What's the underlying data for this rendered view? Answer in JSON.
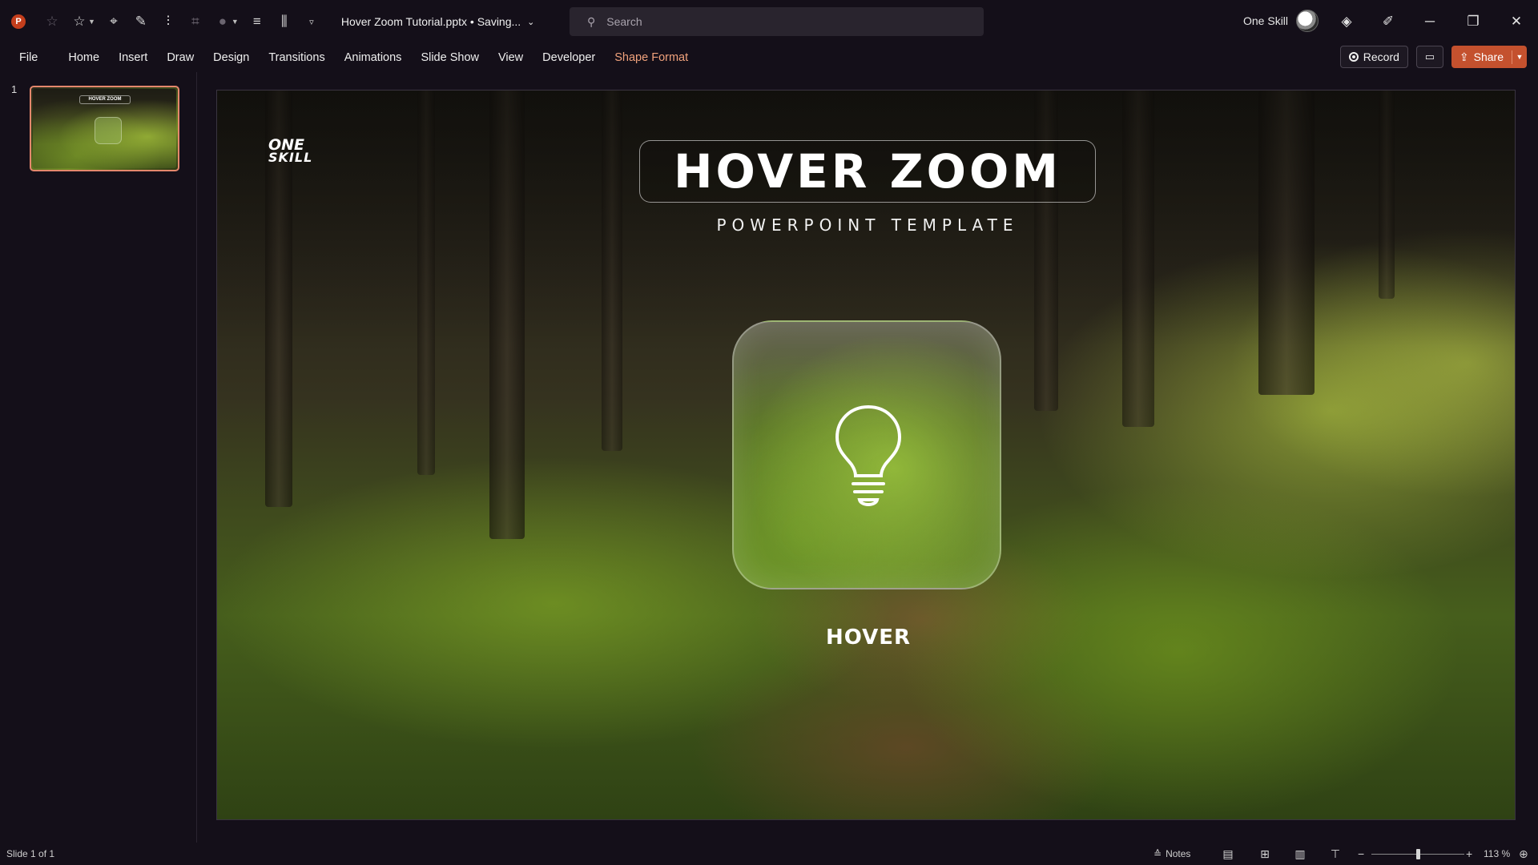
{
  "app": {
    "logo_letter": "P",
    "doc_title": "Hover Zoom Tutorial.pptx • Saving...",
    "quick_access_icons": [
      "autosave-icon",
      "star-icon",
      "lasso-icon",
      "pen-icon",
      "align-icon",
      "crop-icon",
      "shape-fill-icon",
      "distribute-icon",
      "arrange-icon",
      "customize-icon"
    ]
  },
  "search": {
    "placeholder": "Search"
  },
  "user": {
    "name": "One Skill"
  },
  "ribbon": {
    "tabs": [
      "File",
      "Home",
      "Insert",
      "Draw",
      "Design",
      "Transitions",
      "Animations",
      "Slide Show",
      "View",
      "Developer",
      "Shape Format"
    ],
    "accent_tab": "Shape Format",
    "record_label": "Record",
    "share_label": "Share"
  },
  "thumbnails": [
    {
      "number": "1",
      "title": "HOVER ZOOM"
    }
  ],
  "slide": {
    "logo_line1": "ONE",
    "logo_line2": "SKILL",
    "title": "HOVER ZOOM",
    "subtitle": "POWERPOINT TEMPLATE",
    "card_icon": "lightbulb-icon",
    "card_label": "HOVER"
  },
  "statusbar": {
    "slide_count": "Slide 1 of 1",
    "notes_label": "Notes",
    "zoom_value": "113 %",
    "zoom_level_percent": 113
  },
  "colors": {
    "background": "#140f19",
    "accent": "#c4512e",
    "accent_tab_text": "#f0a27c",
    "thumbnail_border": "#e4876c"
  }
}
